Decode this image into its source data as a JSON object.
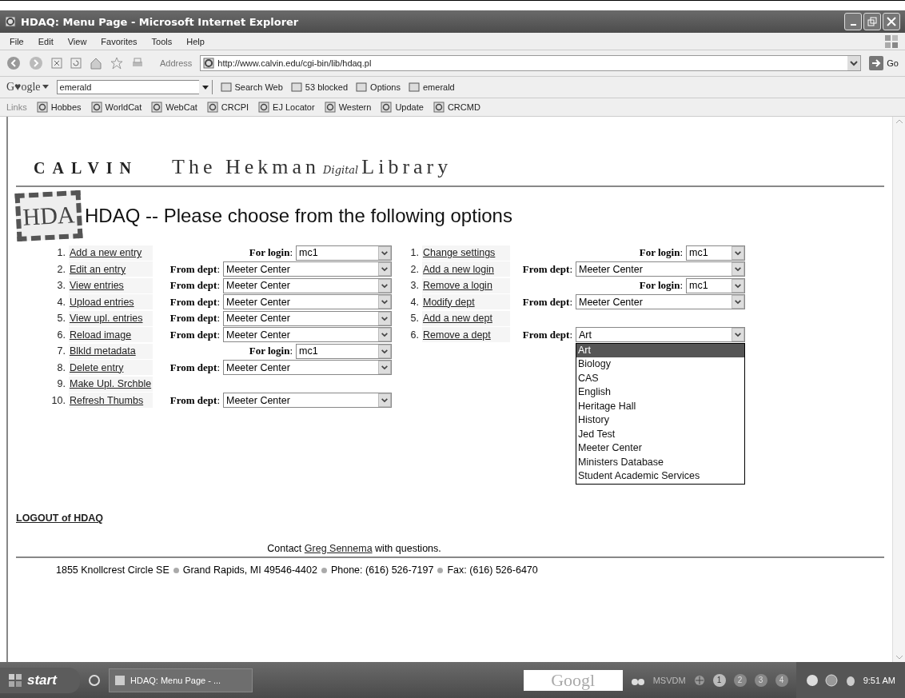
{
  "window": {
    "title": "HDAQ: Menu Page - Microsoft Internet Explorer"
  },
  "menu": [
    "File",
    "Edit",
    "View",
    "Favorites",
    "Tools",
    "Help"
  ],
  "address_bar": {
    "label": "Address",
    "url": "http://www.calvin.edu/cgi-bin/lib/hdaq.pl",
    "go": "Go"
  },
  "google_bar": {
    "logo": "G♥ogle",
    "query": "emerald",
    "buttons": [
      "Search Web",
      "53 blocked",
      "Options",
      "emerald"
    ]
  },
  "links_bar": {
    "label": "Links",
    "items": [
      "Hobbes",
      "WorldCat",
      "WebCat",
      "CRCPI",
      "EJ Locator",
      "Western",
      "Update",
      "CRCMD"
    ]
  },
  "page": {
    "brand": "CALVIN",
    "library": [
      "The Hekman",
      "Digital",
      "Library"
    ],
    "logo": "HDA",
    "heading": "HDAQ -- Please choose from the following options",
    "left_options": [
      {
        "number": "1.",
        "link": "Add a new entry",
        "kind": "login",
        "field_label": "**For login**:",
        "value": "mc1"
      },
      {
        "number": "2.",
        "link": "Edit an entry",
        "kind": "dept",
        "field_label": "**From dept**:",
        "value": "Meeter Center"
      },
      {
        "number": "3.",
        "link": "View entries",
        "kind": "dept",
        "field_label": "**From dept**:",
        "value": "Meeter Center"
      },
      {
        "number": "4.",
        "link": "Upload entries",
        "kind": "dept",
        "field_label": "**From dept**:",
        "value": "Meeter Center"
      },
      {
        "number": "5.",
        "link": "View upl. entries",
        "kind": "dept",
        "field_label": "**From dept**:",
        "value": "Meeter Center"
      },
      {
        "number": "6.",
        "link": "Reload image",
        "kind": "dept",
        "field_label": "**From dept**:",
        "value": "Meeter Center"
      },
      {
        "number": "7.",
        "link": "Blkld metadata",
        "kind": "login",
        "field_label": "**For login**:",
        "value": "mc1"
      },
      {
        "number": "8.",
        "link": "Delete entry",
        "kind": "dept",
        "field_label": "**From dept**:",
        "value": "Meeter Center"
      },
      {
        "number": "9.",
        "link": "Make Upl. Srchble",
        "kind": "none"
      },
      {
        "number": "10.",
        "link": "Refresh Thumbs",
        "kind": "dept",
        "field_label": "**From dept**:",
        "value": "Meeter Center"
      }
    ],
    "right_options": [
      {
        "number": "1.",
        "link": "Change settings",
        "kind": "login",
        "field_label": "**For login**:",
        "value": "mc1"
      },
      {
        "number": "2.",
        "link": "Add a new login",
        "kind": "dept",
        "field_label": "**From dept**:",
        "value": "Meeter Center"
      },
      {
        "number": "3.",
        "link": "Remove a login",
        "kind": "login",
        "field_label": "**For login**:",
        "value": "mc1"
      },
      {
        "number": "4.",
        "link": "Modify dept",
        "kind": "dept",
        "field_label": "**From dept**:",
        "value": "Meeter Center"
      },
      {
        "number": "5.",
        "link": "Add a new dept",
        "kind": "none"
      },
      {
        "number": "6.",
        "link": "Remove a dept",
        "kind": "dept",
        "field_label": "**From dept**:",
        "value": "Art",
        "open": true,
        "options": [
          {
            "label": "Art",
            "selected": true
          },
          {
            "label": "Biology",
            "selected": false
          },
          {
            "label": "CAS",
            "selected": false
          },
          {
            "label": "English",
            "selected": false
          },
          {
            "label": "Heritage Hall",
            "selected": false
          },
          {
            "label": "History",
            "selected": false
          },
          {
            "label": "Jed Test",
            "selected": false
          },
          {
            "label": "Meeter Center",
            "selected": false
          },
          {
            "label": "Ministers Database",
            "selected": false
          },
          {
            "label": "Student Academic Services",
            "selected": false
          }
        ]
      }
    ],
    "logout": "LOGOUT of HDAQ",
    "contact": {
      "before": "Contact",
      "link": "Greg Sennema",
      "after": "with questions."
    },
    "address": [
      "1855 Knollcrest Circle SE",
      "Grand Rapids, MI 49546-4402",
      "Phone: (616) 526-7197",
      "Fax: (616) 526-6470"
    ]
  },
  "taskbar": {
    "start": "start",
    "task": "HDAQ: Menu Page - ...",
    "deskbar": "Googl",
    "label": "MSVDM",
    "desktops": [
      {
        "label": "1",
        "selected": true
      },
      {
        "label": "2",
        "selected": false
      },
      {
        "label": "3",
        "selected": false
      },
      {
        "label": "4",
        "selected": false
      }
    ],
    "clock": "9:51 AM"
  }
}
